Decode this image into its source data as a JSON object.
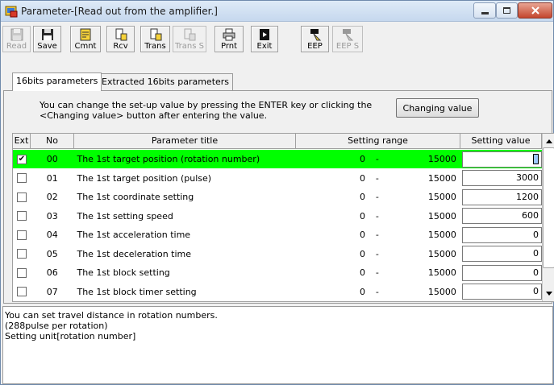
{
  "window": {
    "title": "Parameter-[Read out from the amplifier.]"
  },
  "toolbar": {
    "buttons": [
      {
        "label": "Read",
        "icon": "disk-icon",
        "enabled": false
      },
      {
        "label": "Save",
        "icon": "disk-icon",
        "enabled": true
      },
      {
        "label": "Cmnt",
        "icon": "note-icon",
        "enabled": true
      },
      {
        "label": "Rcv",
        "icon": "receive-icon",
        "enabled": true
      },
      {
        "label": "Trans",
        "icon": "transmit-icon",
        "enabled": true
      },
      {
        "label": "Trans S",
        "icon": "transmit-icon",
        "enabled": false
      },
      {
        "label": "Prnt",
        "icon": "printer-icon",
        "enabled": true
      },
      {
        "label": "Exit",
        "icon": "exit-icon",
        "enabled": true
      },
      {
        "label": "EEP",
        "icon": "eeprom-icon",
        "enabled": true
      },
      {
        "label": "EEP S",
        "icon": "eeprom-icon",
        "enabled": false
      }
    ]
  },
  "tabs": [
    {
      "label": "16bits parameters",
      "active": true
    },
    {
      "label": "Extracted 16bits parameters",
      "active": false
    }
  ],
  "instructions": {
    "line1": "You can change the set-up value by pressing the ENTER key or clicking the",
    "line2": "<Changing value> button after entering the value."
  },
  "changing_button_label": "Changing value",
  "grid": {
    "headers": {
      "ext": "Ext",
      "no": "No",
      "title": "Parameter title",
      "range": "Setting range",
      "value": "Setting value"
    },
    "rows": [
      {
        "checked": true,
        "no": "00",
        "title": "The 1st target position (rotation number)",
        "min": "0",
        "dash": "-",
        "max": "15000",
        "value": "",
        "selected": true
      },
      {
        "checked": false,
        "no": "01",
        "title": "The 1st target position (pulse)",
        "min": "0",
        "dash": "-",
        "max": "15000",
        "value": "3000",
        "selected": false
      },
      {
        "checked": false,
        "no": "02",
        "title": "The 1st coordinate setting",
        "min": "0",
        "dash": "-",
        "max": "15000",
        "value": "1200",
        "selected": false
      },
      {
        "checked": false,
        "no": "03",
        "title": "The 1st setting speed",
        "min": "0",
        "dash": "-",
        "max": "15000",
        "value": "600",
        "selected": false
      },
      {
        "checked": false,
        "no": "04",
        "title": "The 1st acceleration time",
        "min": "0",
        "dash": "-",
        "max": "15000",
        "value": "0",
        "selected": false
      },
      {
        "checked": false,
        "no": "05",
        "title": "The 1st deceleration time",
        "min": "0",
        "dash": "-",
        "max": "15000",
        "value": "0",
        "selected": false
      },
      {
        "checked": false,
        "no": "06",
        "title": "The 1st block setting",
        "min": "0",
        "dash": "-",
        "max": "15000",
        "value": "0",
        "selected": false
      },
      {
        "checked": false,
        "no": "07",
        "title": "The 1st block timer setting",
        "min": "0",
        "dash": "-",
        "max": "15000",
        "value": "0",
        "selected": false
      }
    ]
  },
  "description": {
    "line1": "You can set travel distance in rotation numbers.",
    "line2": "(288pulse per rotation)",
    "line3": "Setting unit[rotation number]"
  },
  "colors": {
    "selected_row": "#00ff00"
  }
}
